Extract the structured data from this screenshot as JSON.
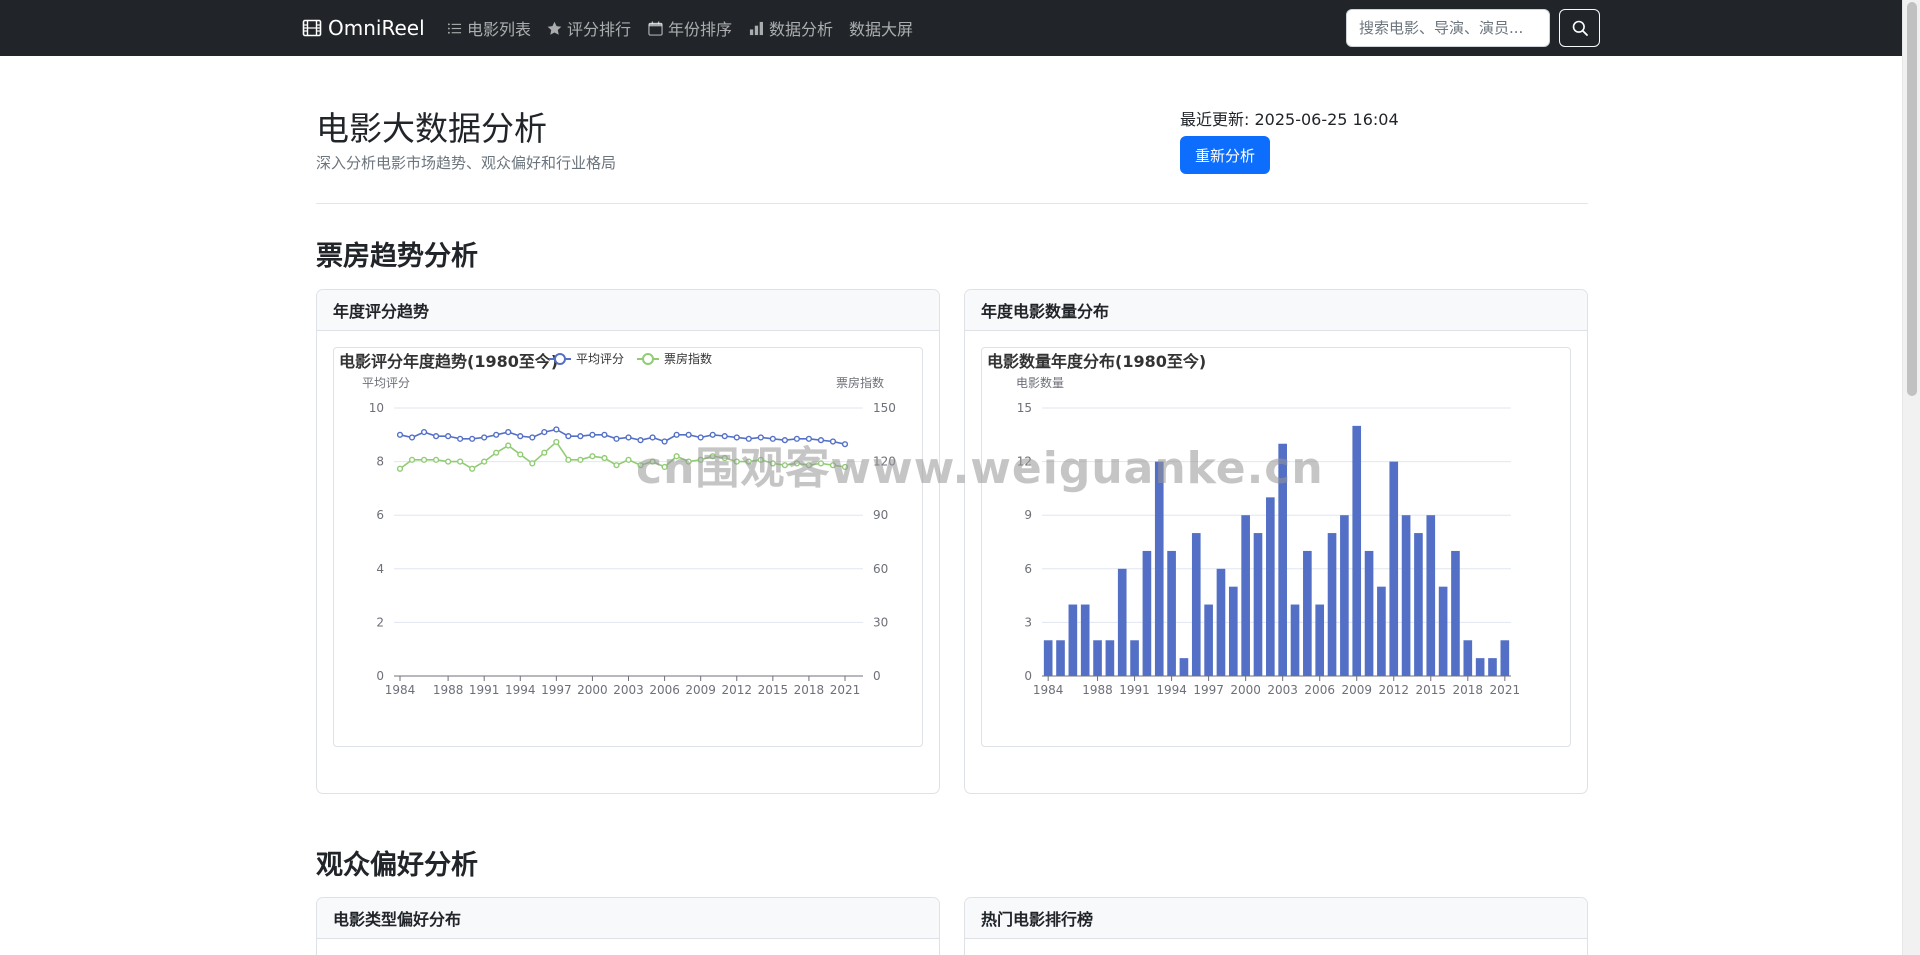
{
  "navbar": {
    "brand": "OmniReel",
    "items": [
      {
        "label": "电影列表",
        "icon": "list-icon"
      },
      {
        "label": "评分排行",
        "icon": "star-icon"
      },
      {
        "label": "年份排序",
        "icon": "calendar-icon"
      },
      {
        "label": "数据分析",
        "icon": "bar-chart-icon"
      },
      {
        "label": "数据大屏",
        "icon": ""
      }
    ],
    "search_placeholder": "搜索电影、导演、演员..."
  },
  "header": {
    "title": "电影大数据分析",
    "subtitle": "深入分析电影市场趋势、观众偏好和行业格局",
    "update_label": "最近更新: 2025-06-25 16:04",
    "reanalyze_label": "重新分析"
  },
  "sections": {
    "box_office": "票房趋势分析",
    "audience": "观众偏好分析"
  },
  "cards": {
    "rating_trend": "年度评分趋势",
    "count_dist": "年度电影数量分布",
    "genre_pref": "电影类型偏好分布",
    "hot_rank": "热门电影排行榜"
  },
  "watermark": "cn围观客www.weiguanke.cn",
  "colors": {
    "navbar": "#212529",
    "primary": "#0d6efd",
    "series_rating": "#5470c6",
    "series_boxoffice": "#91cc75"
  },
  "chart_data": [
    {
      "type": "line",
      "title": "电影评分年度趋势(1980至今)",
      "xlabel": "",
      "ylabel": "平均评分",
      "y2label": "票房指数",
      "ylim": [
        0,
        10
      ],
      "y2lim": [
        0,
        150
      ],
      "yticks": [
        0,
        2,
        4,
        6,
        8,
        10
      ],
      "y2ticks": [
        0,
        30,
        60,
        90,
        120,
        150
      ],
      "xticks": [
        1984,
        1988,
        1991,
        1994,
        1997,
        2000,
        2003,
        2006,
        2009,
        2012,
        2015,
        2018,
        2021
      ],
      "legend_position": "top",
      "x": [
        1984,
        1985,
        1986,
        1987,
        1988,
        1989,
        1990,
        1991,
        1992,
        1993,
        1994,
        1995,
        1996,
        1997,
        1998,
        1999,
        2000,
        2001,
        2002,
        2003,
        2004,
        2005,
        2006,
        2007,
        2008,
        2009,
        2010,
        2011,
        2012,
        2013,
        2014,
        2015,
        2016,
        2017,
        2018,
        2019,
        2020,
        2021
      ],
      "series": [
        {
          "name": "平均评分",
          "axis": "left",
          "values": [
            9.0,
            8.9,
            9.1,
            8.95,
            8.95,
            8.85,
            8.85,
            8.9,
            9.0,
            9.1,
            8.95,
            8.9,
            9.1,
            9.2,
            8.95,
            8.95,
            9.0,
            9.0,
            8.85,
            8.9,
            8.8,
            8.9,
            8.75,
            9.0,
            9.0,
            8.9,
            9.0,
            8.95,
            8.9,
            8.85,
            8.9,
            8.85,
            8.8,
            8.85,
            8.85,
            8.8,
            8.75,
            8.65
          ]
        },
        {
          "name": "票房指数",
          "axis": "right",
          "values": [
            116,
            121,
            121,
            121,
            120,
            120,
            116,
            120,
            125,
            129,
            124,
            119,
            125,
            131,
            121,
            121,
            123,
            122,
            118,
            121,
            118,
            120,
            117,
            123,
            120,
            121,
            123,
            122,
            120,
            120,
            121,
            119,
            118,
            119,
            118,
            119,
            118,
            117
          ]
        }
      ]
    },
    {
      "type": "bar",
      "title": "电影数量年度分布(1980至今)",
      "xlabel": "",
      "ylabel": "电影数量",
      "ylim": [
        0,
        15
      ],
      "yticks": [
        0,
        3,
        6,
        9,
        12,
        15
      ],
      "xticks": [
        1984,
        1988,
        1991,
        1994,
        1997,
        2000,
        2003,
        2006,
        2009,
        2012,
        2015,
        2018,
        2021
      ],
      "categories": [
        1984,
        1985,
        1986,
        1987,
        1988,
        1989,
        1990,
        1991,
        1992,
        1993,
        1994,
        1995,
        1996,
        1997,
        1998,
        1999,
        2000,
        2001,
        2002,
        2003,
        2004,
        2005,
        2006,
        2007,
        2008,
        2009,
        2010,
        2011,
        2012,
        2013,
        2014,
        2015,
        2016,
        2017,
        2018,
        2019,
        2020,
        2021
      ],
      "series": [
        {
          "name": "",
          "values": [
            2,
            2,
            4,
            4,
            2,
            2,
            6,
            2,
            7,
            12,
            7,
            1,
            8,
            4,
            6,
            5,
            9,
            8,
            10,
            13,
            4,
            7,
            4,
            8,
            9,
            14,
            7,
            5,
            12,
            9,
            8,
            9,
            5,
            7,
            2,
            1,
            1,
            2
          ]
        }
      ]
    }
  ]
}
